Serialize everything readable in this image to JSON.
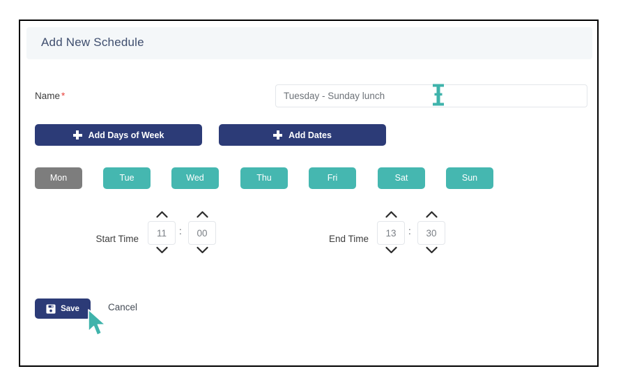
{
  "panel": {
    "title": "Add New Schedule"
  },
  "form": {
    "name": {
      "label": "Name",
      "required_marker": "*",
      "value": "Tuesday - Sunday lunch",
      "placeholder": "Tuesday - Sunday lunch"
    },
    "add_buttons": [
      {
        "id": "add-days-of-week",
        "label": "Add Days of Week",
        "icon": "plus-icon"
      },
      {
        "id": "add-dates",
        "label": "Add Dates",
        "icon": "plus-icon"
      }
    ],
    "days": [
      {
        "key": "mon",
        "label": "Mon",
        "selected": false
      },
      {
        "key": "tue",
        "label": "Tue",
        "selected": true
      },
      {
        "key": "wed",
        "label": "Wed",
        "selected": true
      },
      {
        "key": "thu",
        "label": "Thu",
        "selected": true
      },
      {
        "key": "fri",
        "label": "Fri",
        "selected": true
      },
      {
        "key": "sat",
        "label": "Sat",
        "selected": true
      },
      {
        "key": "sun",
        "label": "Sun",
        "selected": true
      }
    ],
    "start_time": {
      "label": "Start Time",
      "hours": "11",
      "minutes": "00",
      "separator": ":"
    },
    "end_time": {
      "label": "End Time",
      "hours": "13",
      "minutes": "30",
      "separator": ":"
    }
  },
  "actions": {
    "save_label": "Save",
    "save_icon": "floppy-disk-save-icon",
    "cancel_label": "Cancel"
  },
  "colors": {
    "navy": "#2c3b77",
    "teal": "#45b7b0",
    "gray_chip": "#7d7d7d",
    "header_bg": "#f4f7f9",
    "title_text": "#3f4e6e",
    "required_red": "#e8413b",
    "cursor_teal": "#3fb3ab"
  },
  "cursors": {
    "text_caret": "i-beam-text-cursor",
    "pointer": "arrow-mouse-cursor"
  }
}
